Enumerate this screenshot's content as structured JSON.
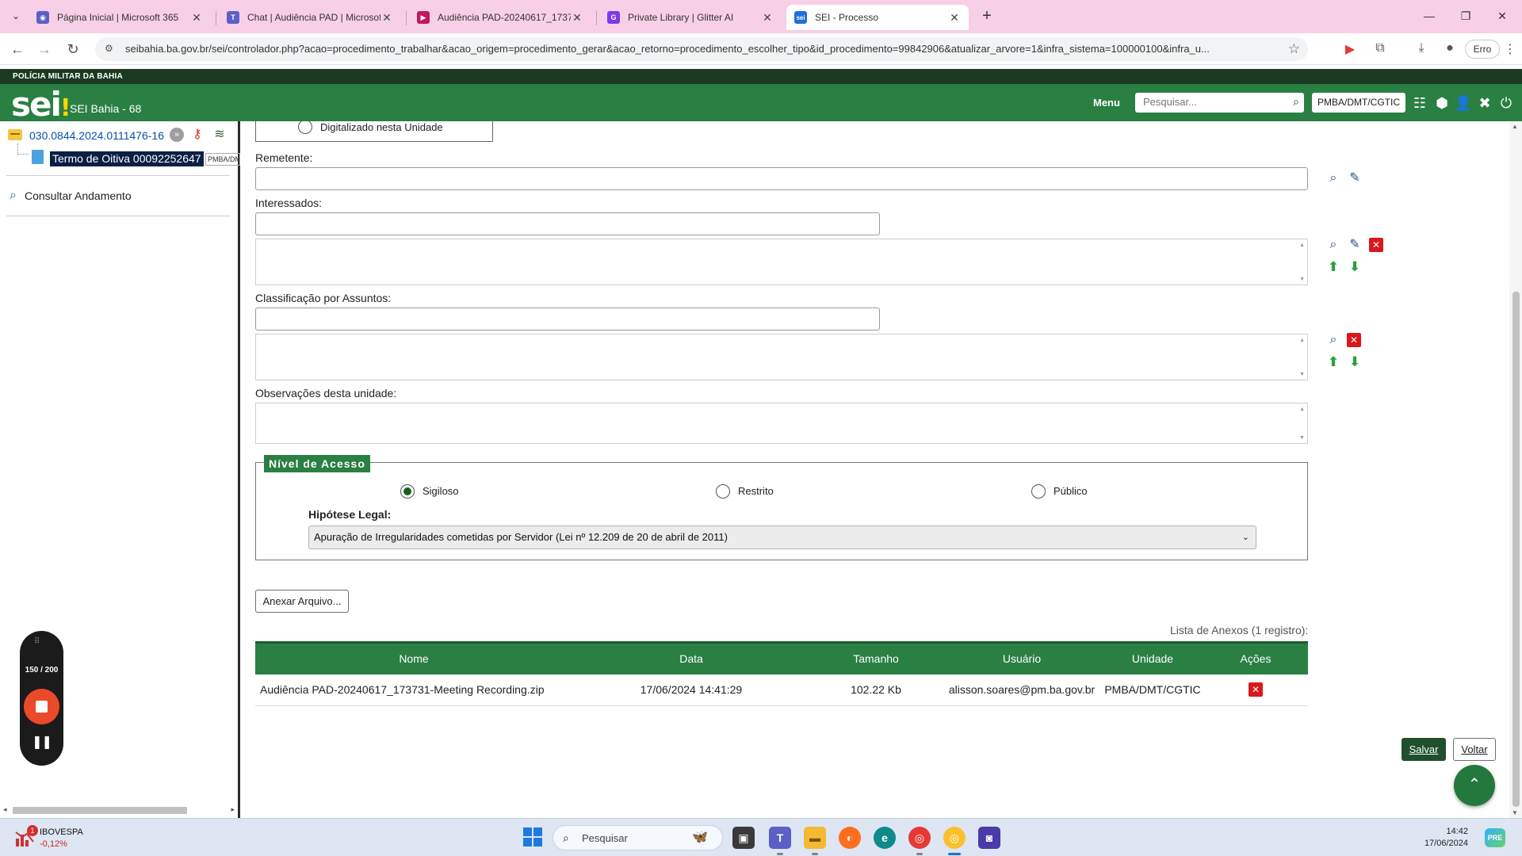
{
  "browser": {
    "tabs": [
      {
        "title": "Página Inicial | Microsoft 365",
        "favicon": "m365-icon",
        "color": "#5b5fc7",
        "glyph": "◉"
      },
      {
        "title": "Chat | Audiência PAD | Microsof",
        "favicon": "teams-icon",
        "color": "#5b5fc7",
        "glyph": "T"
      },
      {
        "title": "Audiência PAD-20240617_1737",
        "favicon": "stream-icon",
        "color": "#c2185b",
        "glyph": "▶"
      },
      {
        "title": "Private Library | Glitter AI",
        "favicon": "glitter-icon",
        "color": "#7c3aed",
        "glyph": "G"
      },
      {
        "title": "SEI - Processo",
        "favicon": "sei-icon",
        "color": "#1e6fd9",
        "glyph": "sei"
      }
    ],
    "new_tab": "+",
    "url": "seibahia.ba.gov.br/sei/controlador.php?acao=procedimento_trabalhar&acao_origem=procedimento_gerar&acao_retorno=procedimento_escolher_tipo&id_procedimento=99842906&atualizar_arvore=1&infra_sistema=100000100&infra_u...",
    "profile_status": "Erro"
  },
  "header": {
    "org": "POLÍCIA MILITAR DA BAHIA",
    "logo": "sei",
    "app_name": "SEI Bahia - 68",
    "menu_label": "Menu",
    "search_placeholder": "Pesquisar...",
    "unit": "PMBA/DMT/CGTIC"
  },
  "tree": {
    "process_number": "030.0844.2024.0111476-16",
    "document": "Termo de Oitiva 00092252647",
    "document_unit": "PMBA/DMT/CGTIC",
    "consultar": "Consultar Andamento"
  },
  "recorder": {
    "count": "150 / 200"
  },
  "form": {
    "digitalizado_label": "Digitalizado nesta Unidade",
    "remetente_label": "Remetente:",
    "interessados_label": "Interessados:",
    "classificacao_label": "Classificação por Assuntos:",
    "observacoes_label": "Observações desta unidade:",
    "nivel_acesso": {
      "legend": "Nível de Acesso",
      "options": [
        "Sigiloso",
        "Restrito",
        "Público"
      ],
      "selected": "Sigiloso",
      "hipotese_label": "Hipótese Legal:",
      "hipotese_value": "Apuração de Irregularidades cometidas por Servidor (Lei nº 12.209 de 20 de abril de 2011)"
    },
    "anexar_button": "Anexar Arquivo...",
    "anexos": {
      "caption": "Lista de Anexos (1 registro):",
      "headers": [
        "Nome",
        "Data",
        "Tamanho",
        "Usuário",
        "Unidade",
        "Ações"
      ],
      "rows": [
        {
          "nome": "Audiência PAD-20240617_173731-Meeting Recording.zip",
          "data": "17/06/2024 14:41:29",
          "tamanho": "102.22 Kb",
          "usuario": "alisson.soares@pm.ba.gov.br",
          "unidade": "PMBA/DMT/CGTIC"
        }
      ]
    },
    "salvar_button": "Salvar",
    "voltar_button": "Voltar"
  },
  "taskbar": {
    "widget_name": "IBOVESPA",
    "widget_change": "-0,12%",
    "widget_badge": "1",
    "search_text": "Pesquisar",
    "time": "14:42",
    "date": "17/06/2024",
    "notif": "PRE"
  }
}
